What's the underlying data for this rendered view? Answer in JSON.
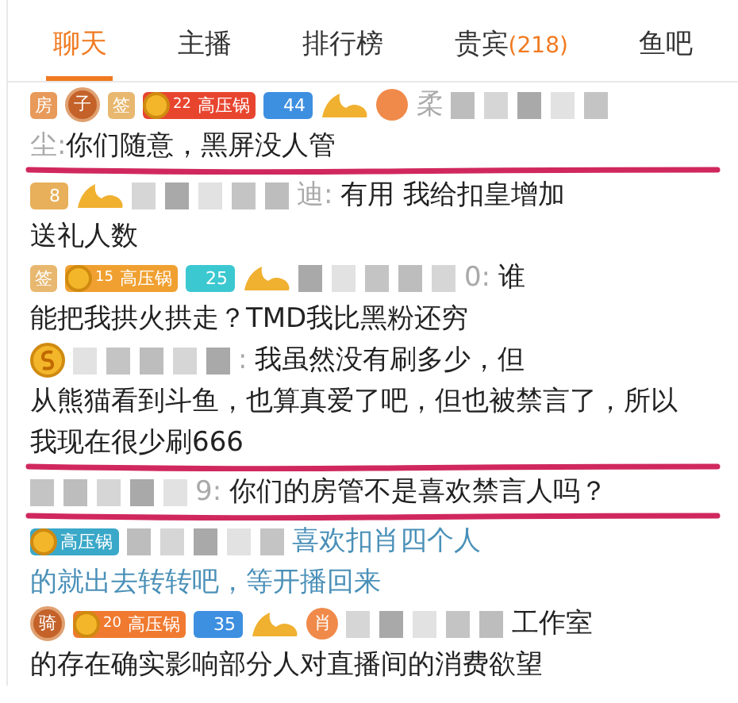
{
  "tabs": [
    {
      "label": "聊天",
      "selected": true
    },
    {
      "label": "主播",
      "selected": false
    },
    {
      "label": "排行榜",
      "selected": false
    },
    {
      "label": "贵宾",
      "count": "(218)",
      "selected": false
    },
    {
      "label": "鱼吧",
      "selected": false
    }
  ],
  "messages": [
    {
      "badges": [
        {
          "kind": "room",
          "text": "房"
        },
        {
          "kind": "rank",
          "text": "子"
        },
        {
          "kind": "sign",
          "text": "签"
        },
        {
          "kind": "fan",
          "level": "22",
          "label": "高压锅",
          "color": "#e8452f"
        },
        {
          "kind": "level",
          "text": "44",
          "color": "#3d8fe0"
        },
        {
          "kind": "noble"
        },
        {
          "kind": "medal",
          "color": "#f08a4a"
        }
      ],
      "name_start": "柔",
      "censored": true,
      "lines": [
        {
          "name": "尘:",
          "text": "你们随意，黑屏没人管"
        }
      ],
      "highlighted": false,
      "underlined": true
    },
    {
      "badges": [
        {
          "kind": "level",
          "text": "8",
          "color": "#e8b05a"
        },
        {
          "kind": "noble"
        }
      ],
      "censored": true,
      "name_end": "迪:",
      "text_start": "有用 我给扣皇增加",
      "lines": [
        {
          "text": "送礼人数"
        }
      ],
      "highlighted": false,
      "underlined": false
    },
    {
      "badges": [
        {
          "kind": "sign",
          "text": "签"
        },
        {
          "kind": "fan",
          "level": "15",
          "label": "高压锅",
          "color": "#f0a030"
        },
        {
          "kind": "level",
          "text": "25",
          "color": "#3cc8d0"
        },
        {
          "kind": "noble"
        }
      ],
      "censored": true,
      "name_end": "0:",
      "text_start": "谁",
      "lines": [
        {
          "text": "能把我拱火拱走？TMD我比黑粉还穷"
        }
      ],
      "highlighted": false,
      "underlined": false
    },
    {
      "badges": [
        {
          "kind": "coin"
        }
      ],
      "censored": true,
      "name_end": ":",
      "text_start": "我虽然没有刷多少，但",
      "lines": [
        {
          "text": "从熊猫看到斗鱼，也算真爱了吧，但也被禁言了，所以"
        },
        {
          "text": "我现在很少刷666"
        }
      ],
      "highlighted": false,
      "underlined": true
    },
    {
      "censored": true,
      "name_end": "9:",
      "text_start": "你们的房管不是喜欢禁言人吗？",
      "highlighted": false,
      "underlined": true
    },
    {
      "badges": [
        {
          "kind": "fan",
          "label": "高压锅",
          "color": "#3aa8c8"
        }
      ],
      "censored": true,
      "text_start": "喜欢扣肖四个人",
      "lines": [
        {
          "text": "的就出去转转吧，等开播回来"
        }
      ],
      "highlighted": true,
      "underlined": false
    },
    {
      "badges": [
        {
          "kind": "rank",
          "text": "骑"
        },
        {
          "kind": "fan",
          "level": "20",
          "label": "高压锅",
          "color": "#f07a30"
        },
        {
          "kind": "level",
          "text": "35",
          "color": "#3d8fe0"
        },
        {
          "kind": "noble"
        },
        {
          "kind": "medal",
          "text": "肖",
          "color": "#f08a4a"
        }
      ],
      "censored": true,
      "text_start": "工作室",
      "lines": [
        {
          "text": "的存在确实影响部分人对直播间的消费欲望"
        }
      ],
      "highlighted": false,
      "underlined": false
    }
  ]
}
